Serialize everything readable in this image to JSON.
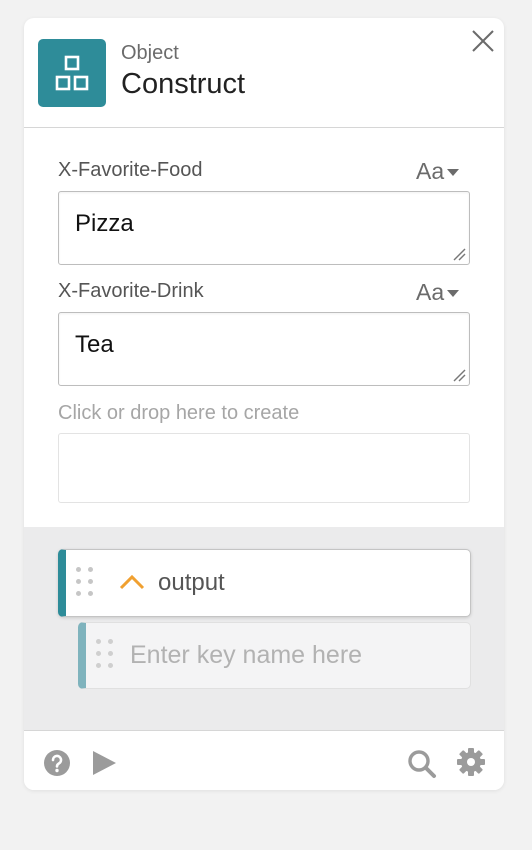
{
  "header": {
    "kind": "Object",
    "title": "Construct",
    "icon": "objects-icon",
    "accent_color": "#2e8c99"
  },
  "fields": [
    {
      "label": "X-Favorite-Food",
      "value": "Pizza",
      "type_toggle": "Aa"
    },
    {
      "label": "X-Favorite-Drink",
      "value": "Tea",
      "type_toggle": "Aa"
    }
  ],
  "create": {
    "label": "Click or drop here to create"
  },
  "output": {
    "name": "output",
    "key_placeholder": "Enter key name here",
    "collapse_icon": "chevron-up-icon",
    "chevron_color": "#f0a030"
  },
  "footer": {
    "icons": [
      "help-icon",
      "play-icon",
      "search-icon",
      "settings-icon"
    ]
  }
}
